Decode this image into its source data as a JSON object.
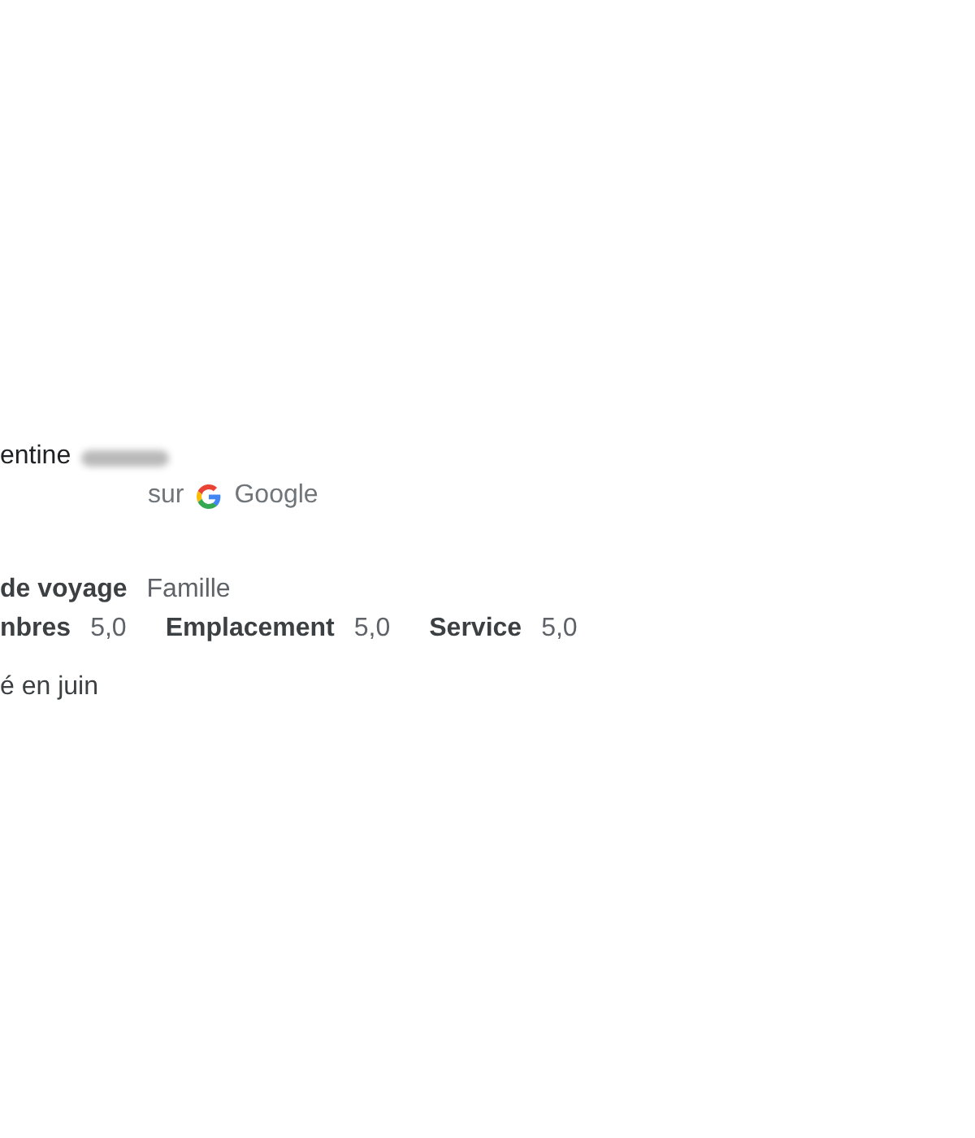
{
  "reviewer": {
    "name": "entine"
  },
  "source": {
    "prefix": "sur",
    "name": "Google"
  },
  "trip_type": {
    "label": "de voyage",
    "value": "Famille"
  },
  "ratings": [
    {
      "label": "nbres",
      "value": "5,0"
    },
    {
      "label": "Emplacement",
      "value": "5,0"
    },
    {
      "label": "Service",
      "value": "5,0"
    }
  ],
  "visit_note": "é en juin"
}
